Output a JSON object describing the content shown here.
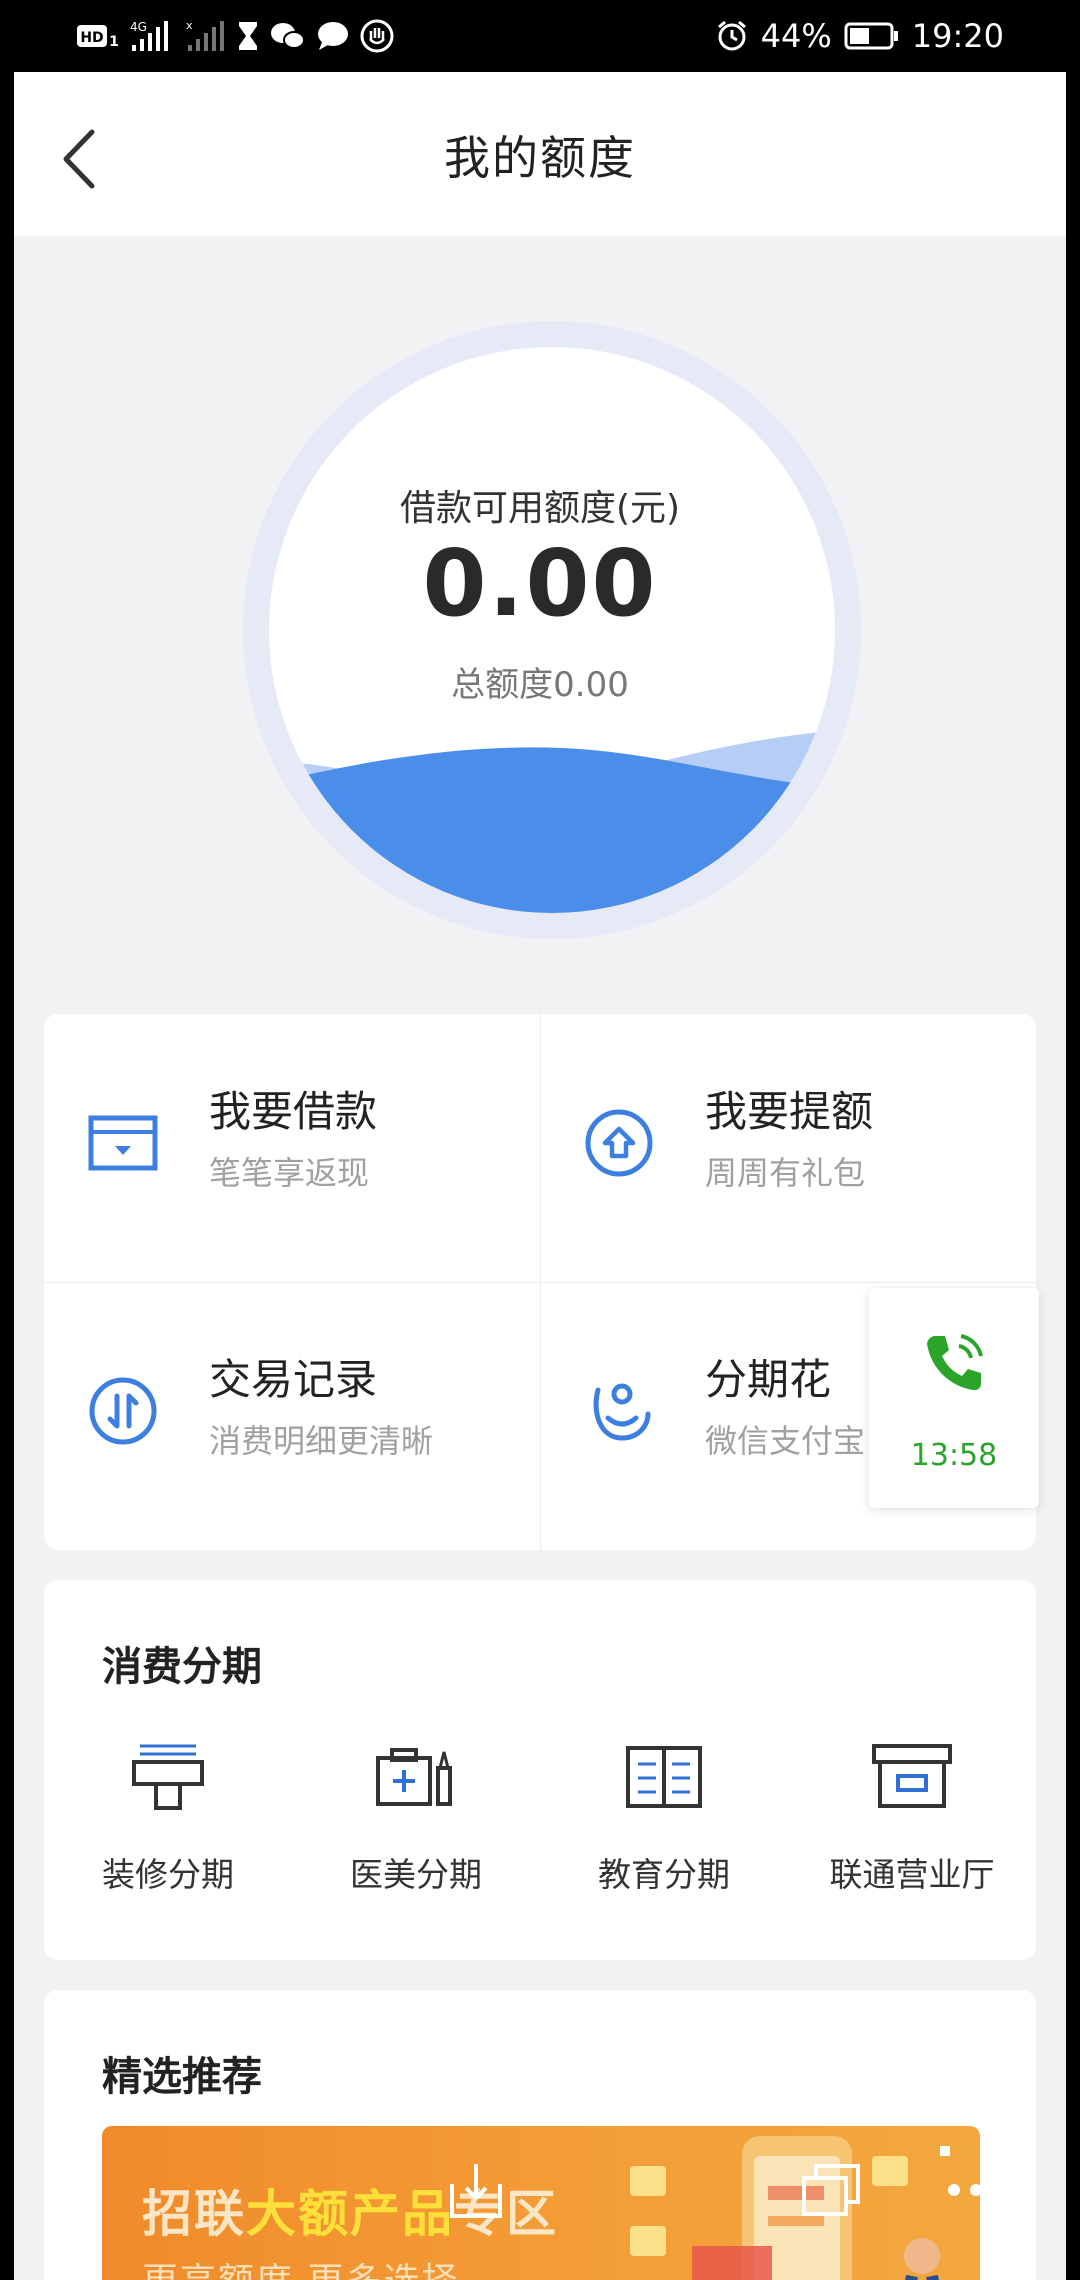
{
  "status_bar": {
    "battery": "44%",
    "time": "19:20",
    "icons": [
      "hd-icon",
      "signal-4g-icon",
      "signal-icon",
      "hourglass-icon",
      "wechat-icon",
      "chat-bubble-icon",
      "hand-icon",
      "alarm-icon",
      "battery-icon"
    ]
  },
  "header": {
    "title": "我的额度",
    "back_icon": "chevron-left-icon"
  },
  "quota": {
    "label": "借款可用额度(元)",
    "value": "0.00",
    "total": "总额度0.00",
    "fill_level": 0.28,
    "accent": "#4a8eea"
  },
  "actions": [
    {
      "title": "我要借款",
      "subtitle": "笔笔享返现",
      "icon": "wallet-icon"
    },
    {
      "title": "我要提额",
      "subtitle": "周周有礼包",
      "icon": "raise-limit-icon"
    },
    {
      "title": "交易记录",
      "subtitle": "消费明细更清晰",
      "icon": "transactions-icon"
    },
    {
      "title": "分期花",
      "subtitle": "微信支付宝",
      "icon": "installment-pay-icon"
    }
  ],
  "call_bubble": {
    "time": "13:58",
    "color": "#2aa52a",
    "icon": "phone-icon"
  },
  "installment": {
    "title": "消费分期",
    "items": [
      {
        "label": "装修分期",
        "icon": "renovation-icon"
      },
      {
        "label": "医美分期",
        "icon": "medical-beauty-icon"
      },
      {
        "label": "教育分期",
        "icon": "education-book-icon"
      },
      {
        "label": "联通营业厅",
        "icon": "store-box-icon"
      }
    ]
  },
  "recommend": {
    "title": "精选推荐",
    "banner": {
      "title_a": "招联",
      "title_b": "大额产品",
      "title_c": "专区",
      "subtitle": "更高额度 更多选择"
    }
  },
  "overlay": {
    "icons": [
      "download-icon",
      "windows-icon",
      "more-icon"
    ]
  }
}
